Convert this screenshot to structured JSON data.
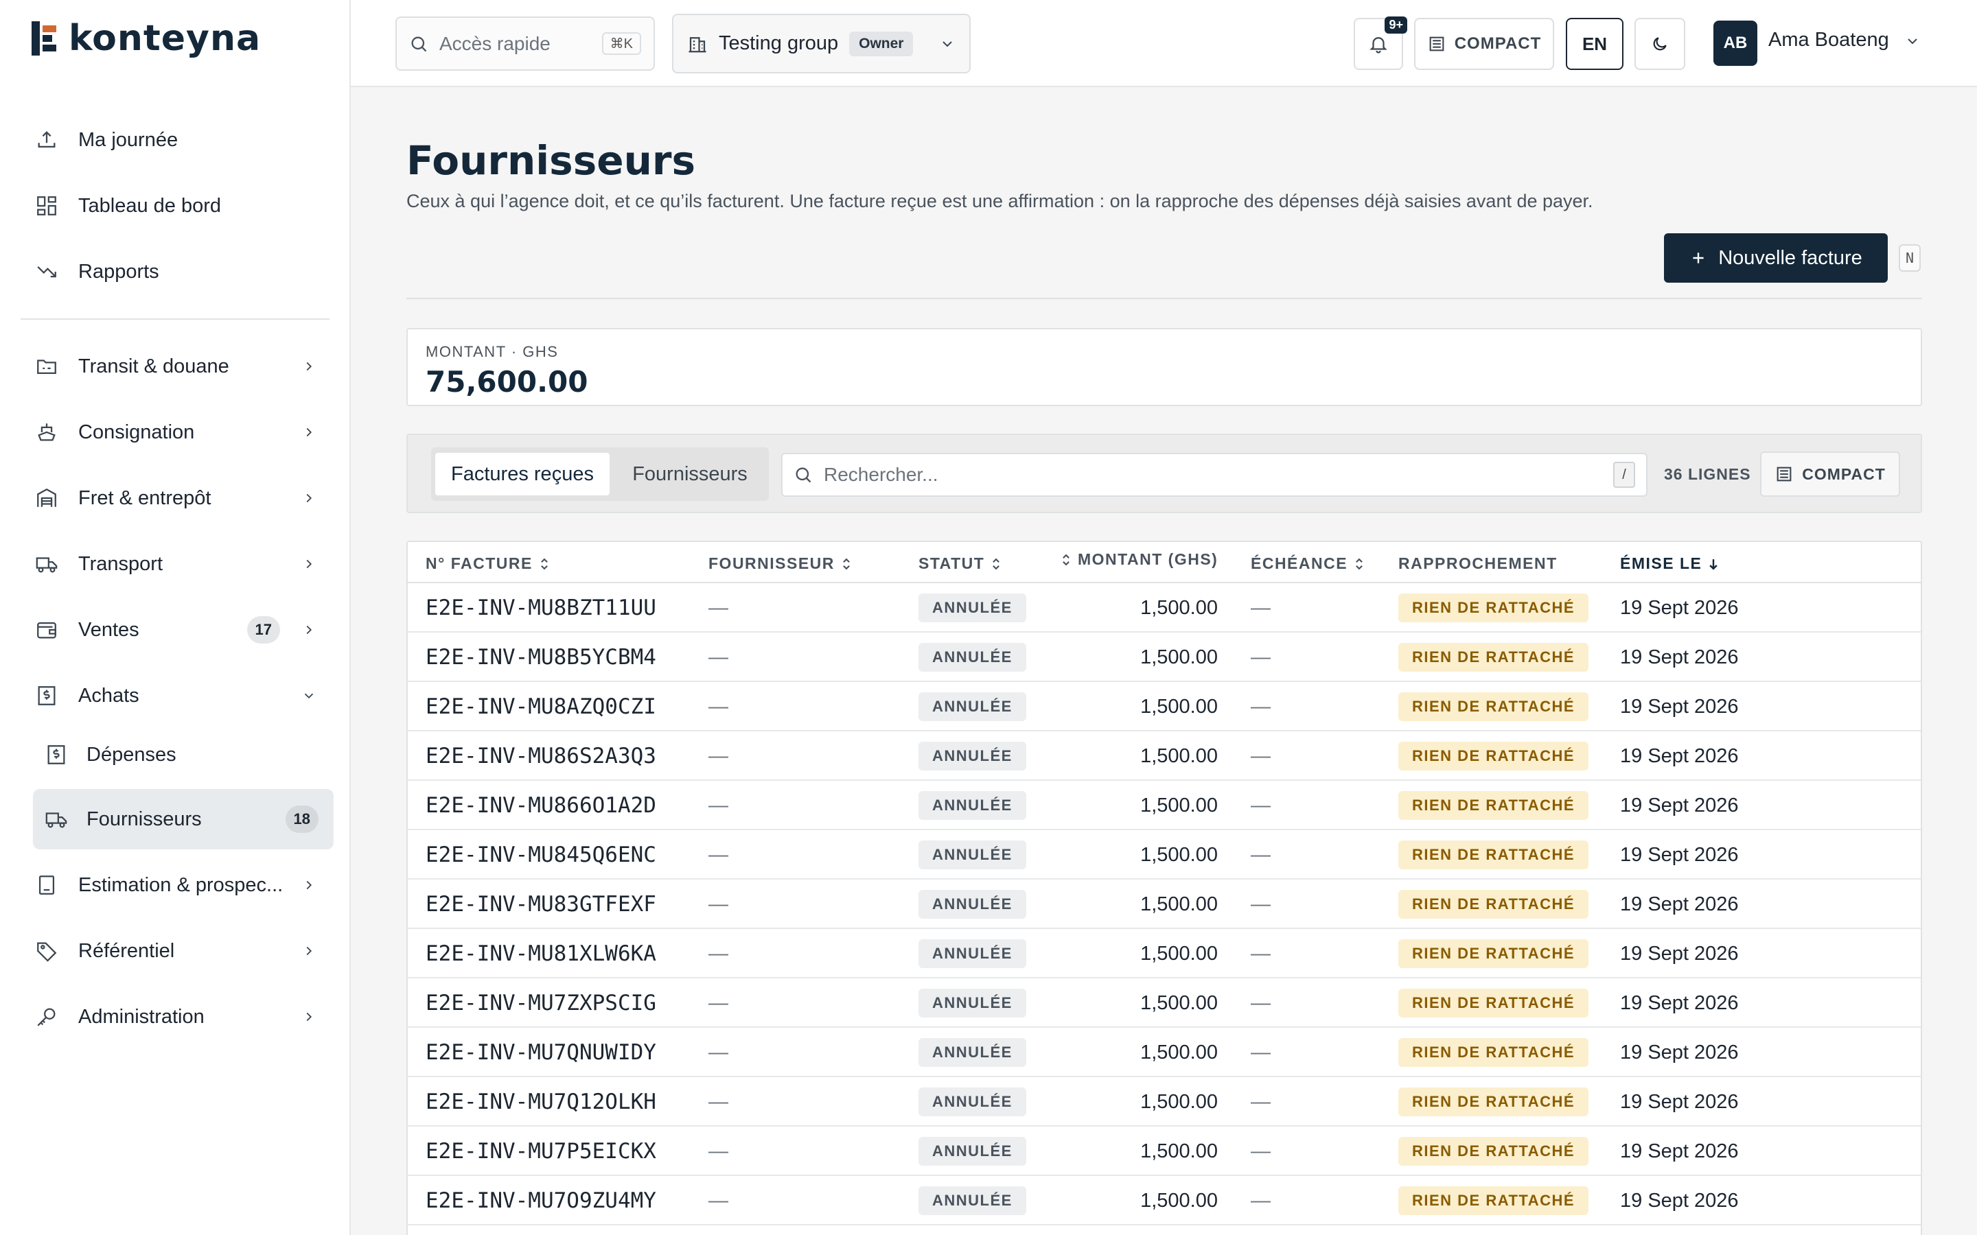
{
  "app": {
    "name": "konteyna"
  },
  "sidebar": {
    "items": [
      {
        "label": "Ma journée",
        "icon": "upload-tray-icon"
      },
      {
        "label": "Tableau de bord",
        "icon": "dashboard-grid-icon"
      },
      {
        "label": "Rapports",
        "icon": "trend-down-icon"
      },
      {
        "label": "Transit & douane",
        "icon": "customs-folder-icon"
      },
      {
        "label": "Consignation",
        "icon": "ship-icon"
      },
      {
        "label": "Fret & entrepôt",
        "icon": "warehouse-icon"
      },
      {
        "label": "Transport",
        "icon": "truck-icon"
      },
      {
        "label": "Ventes",
        "icon": "wallet-icon",
        "badge": "17"
      },
      {
        "label": "Achats",
        "icon": "dollar-document-icon"
      },
      {
        "label": "Dépenses",
        "icon": "dollar-document-icon"
      },
      {
        "label": "Fournisseurs",
        "icon": "truck-icon",
        "badge": "18"
      },
      {
        "label": "Estimation & prospec...",
        "icon": "calculator-icon"
      },
      {
        "label": "Référentiel",
        "icon": "tag-icon"
      },
      {
        "label": "Administration",
        "icon": "key-icon"
      }
    ]
  },
  "topbar": {
    "quick_access": {
      "placeholder": "Accès rapide",
      "shortcut": "⌘K"
    },
    "group": {
      "name": "Testing group",
      "role": "Owner"
    },
    "notifications_badge": "9+",
    "compact_label": "COMPACT",
    "lang_label": "EN",
    "user": {
      "initials": "AB",
      "name": "Ama Boateng"
    }
  },
  "page": {
    "title": "Fournisseurs",
    "subtitle": "Ceux à qui l’agence doit, et ce qu’ils facturent. Une facture reçue est une affirmation : on la rapproche des dépenses déjà saisies avant de payer.",
    "new_button": "Nouvelle facture",
    "new_shortcut": "N"
  },
  "summary": {
    "label": "MONTANT · GHS",
    "value": "75,600.00"
  },
  "toolbar": {
    "tabs": [
      "Factures reçues",
      "Fournisseurs"
    ],
    "search_placeholder": "Rechercher...",
    "search_shortcut": "/",
    "rows_count": "36 LIGNES",
    "compact_label": "COMPACT"
  },
  "table": {
    "headers": [
      "N° FACTURE",
      "FOURNISSEUR",
      "STATUT",
      "MONTANT (GHS)",
      "ÉCHÉANCE",
      "RAPPROCHEMENT",
      "ÉMISE LE"
    ],
    "rows": [
      {
        "num": "E2E-INV-MU8BZT11UU",
        "fournisseur": "—",
        "statut": "ANNULÉE",
        "montant": "1,500.00",
        "echeance": "—",
        "rapprochement": "RIEN DE RATTACHÉ",
        "emise": "19 Sept 2026"
      },
      {
        "num": "E2E-INV-MU8B5YCBM4",
        "fournisseur": "—",
        "statut": "ANNULÉE",
        "montant": "1,500.00",
        "echeance": "—",
        "rapprochement": "RIEN DE RATTACHÉ",
        "emise": "19 Sept 2026"
      },
      {
        "num": "E2E-INV-MU8AZQ0CZI",
        "fournisseur": "—",
        "statut": "ANNULÉE",
        "montant": "1,500.00",
        "echeance": "—",
        "rapprochement": "RIEN DE RATTACHÉ",
        "emise": "19 Sept 2026"
      },
      {
        "num": "E2E-INV-MU86S2A3Q3",
        "fournisseur": "—",
        "statut": "ANNULÉE",
        "montant": "1,500.00",
        "echeance": "—",
        "rapprochement": "RIEN DE RATTACHÉ",
        "emise": "19 Sept 2026"
      },
      {
        "num": "E2E-INV-MU866O1A2D",
        "fournisseur": "—",
        "statut": "ANNULÉE",
        "montant": "1,500.00",
        "echeance": "—",
        "rapprochement": "RIEN DE RATTACHÉ",
        "emise": "19 Sept 2026"
      },
      {
        "num": "E2E-INV-MU845Q6ENC",
        "fournisseur": "—",
        "statut": "ANNULÉE",
        "montant": "1,500.00",
        "echeance": "—",
        "rapprochement": "RIEN DE RATTACHÉ",
        "emise": "19 Sept 2026"
      },
      {
        "num": "E2E-INV-MU83GTFEXF",
        "fournisseur": "—",
        "statut": "ANNULÉE",
        "montant": "1,500.00",
        "echeance": "—",
        "rapprochement": "RIEN DE RATTACHÉ",
        "emise": "19 Sept 2026"
      },
      {
        "num": "E2E-INV-MU81XLW6KA",
        "fournisseur": "—",
        "statut": "ANNULÉE",
        "montant": "1,500.00",
        "echeance": "—",
        "rapprochement": "RIEN DE RATTACHÉ",
        "emise": "19 Sept 2026"
      },
      {
        "num": "E2E-INV-MU7ZXPSCIG",
        "fournisseur": "—",
        "statut": "ANNULÉE",
        "montant": "1,500.00",
        "echeance": "—",
        "rapprochement": "RIEN DE RATTACHÉ",
        "emise": "19 Sept 2026"
      },
      {
        "num": "E2E-INV-MU7QNUWIDY",
        "fournisseur": "—",
        "statut": "ANNULÉE",
        "montant": "1,500.00",
        "echeance": "—",
        "rapprochement": "RIEN DE RATTACHÉ",
        "emise": "19 Sept 2026"
      },
      {
        "num": "E2E-INV-MU7Q12OLKH",
        "fournisseur": "—",
        "statut": "ANNULÉE",
        "montant": "1,500.00",
        "echeance": "—",
        "rapprochement": "RIEN DE RATTACHÉ",
        "emise": "19 Sept 2026"
      },
      {
        "num": "E2E-INV-MU7P5EICKX",
        "fournisseur": "—",
        "statut": "ANNULÉE",
        "montant": "1,500.00",
        "echeance": "—",
        "rapprochement": "RIEN DE RATTACHÉ",
        "emise": "19 Sept 2026"
      },
      {
        "num": "E2E-INV-MU7O9ZU4MY",
        "fournisseur": "—",
        "statut": "ANNULÉE",
        "montant": "1,500.00",
        "echeance": "—",
        "rapprochement": "RIEN DE RATTACHÉ",
        "emise": "19 Sept 2026"
      }
    ]
  },
  "colors": {
    "brand_dark": "#14283a",
    "accent_amber": "#8a5b00",
    "amber_bg": "#fbefcd"
  }
}
